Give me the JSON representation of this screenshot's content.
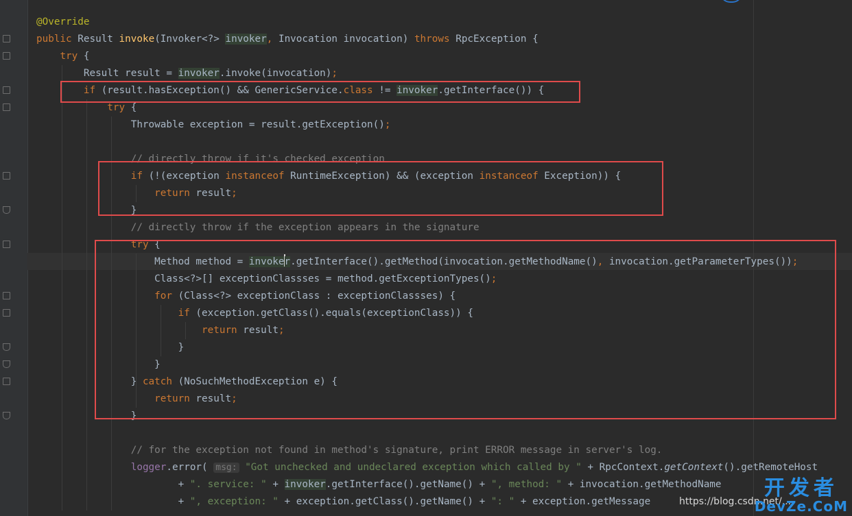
{
  "editor": {
    "lines": [
      [
        {
          "t": "@Override",
          "c": "ann"
        }
      ],
      [
        {
          "t": "public ",
          "c": "kw"
        },
        {
          "t": "Result "
        },
        {
          "t": "invoke",
          "c": "fn"
        },
        {
          "t": "(Invoker<?> "
        },
        {
          "t": "invoker",
          "c": "hl"
        },
        {
          "t": ", ",
          "c": "kw"
        },
        {
          "t": "Invocation invocation) "
        },
        {
          "t": "throws ",
          "c": "kw"
        },
        {
          "t": "RpcException {"
        }
      ],
      [
        {
          "t": "    "
        },
        {
          "t": "try ",
          "c": "kw"
        },
        {
          "t": "{"
        }
      ],
      [
        {
          "t": "        Result result = "
        },
        {
          "t": "invoker",
          "c": "hl"
        },
        {
          "t": ".invoke(invocation)"
        },
        {
          "t": ";",
          "c": "kw"
        }
      ],
      [
        {
          "t": "        "
        },
        {
          "t": "if ",
          "c": "kw"
        },
        {
          "t": "(result.hasException() && GenericService."
        },
        {
          "t": "class ",
          "c": "kw"
        },
        {
          "t": "!= "
        },
        {
          "t": "invoker",
          "c": "hl"
        },
        {
          "t": ".getInterface()) {"
        }
      ],
      [
        {
          "t": "            "
        },
        {
          "t": "try ",
          "c": "kw"
        },
        {
          "t": "{"
        }
      ],
      [
        {
          "t": "                Throwable exception = result.getException()"
        },
        {
          "t": ";",
          "c": "kw"
        }
      ],
      [],
      [
        {
          "t": "                "
        },
        {
          "t": "// directly throw if it's checked exception",
          "c": "cm"
        }
      ],
      [
        {
          "t": "                "
        },
        {
          "t": "if ",
          "c": "kw"
        },
        {
          "t": "(!(exception "
        },
        {
          "t": "instanceof ",
          "c": "kw"
        },
        {
          "t": "RuntimeException) && (exception "
        },
        {
          "t": "instanceof ",
          "c": "kw"
        },
        {
          "t": "Exception)) {"
        }
      ],
      [
        {
          "t": "                    "
        },
        {
          "t": "return ",
          "c": "kw"
        },
        {
          "t": "result"
        },
        {
          "t": ";",
          "c": "kw"
        }
      ],
      [
        {
          "t": "                }"
        }
      ],
      [
        {
          "t": "                "
        },
        {
          "t": "// directly throw if the exception appears in the signature",
          "c": "cm"
        }
      ],
      [
        {
          "t": "                "
        },
        {
          "t": "try ",
          "c": "kw"
        },
        {
          "t": "{"
        }
      ],
      [
        {
          "t": "                    Method method = "
        },
        {
          "t": "invoke",
          "c": "hl"
        },
        {
          "t": "",
          "c": "cursor"
        },
        {
          "t": "r",
          "c": "hl"
        },
        {
          "t": ".getInterface().getMethod(invocation.getMethodName()"
        },
        {
          "t": ", ",
          "c": "kw"
        },
        {
          "t": "invocation.getParameterTypes())"
        },
        {
          "t": ";",
          "c": "kw"
        }
      ],
      [
        {
          "t": "                    Class<?>[] exceptionClassses = method.getExceptionTypes()"
        },
        {
          "t": ";",
          "c": "kw"
        }
      ],
      [
        {
          "t": "                    "
        },
        {
          "t": "for ",
          "c": "kw"
        },
        {
          "t": "(Class<?> exceptionClass : exceptionClassses) {"
        }
      ],
      [
        {
          "t": "                        "
        },
        {
          "t": "if ",
          "c": "kw"
        },
        {
          "t": "(exception.getClass().equals(exceptionClass)) {"
        }
      ],
      [
        {
          "t": "                            "
        },
        {
          "t": "return ",
          "c": "kw"
        },
        {
          "t": "result"
        },
        {
          "t": ";",
          "c": "kw"
        }
      ],
      [
        {
          "t": "                        }"
        }
      ],
      [
        {
          "t": "                    }"
        }
      ],
      [
        {
          "t": "                } "
        },
        {
          "t": "catch ",
          "c": "kw"
        },
        {
          "t": "(NoSuchMethodException e) {"
        }
      ],
      [
        {
          "t": "                    "
        },
        {
          "t": "return ",
          "c": "kw"
        },
        {
          "t": "result"
        },
        {
          "t": ";",
          "c": "kw"
        }
      ],
      [
        {
          "t": "                }"
        }
      ],
      [],
      [
        {
          "t": "                "
        },
        {
          "t": "// for the exception not found in method's signature, print ERROR message in server's log.",
          "c": "cm"
        }
      ],
      [
        {
          "t": "                "
        },
        {
          "t": "logger",
          "c": "fld"
        },
        {
          "t": ".error( "
        },
        {
          "t": "msg:",
          "c": "hint"
        },
        {
          "t": " "
        },
        {
          "t": "\"Got unchecked and undeclared exception which called by \" ",
          "c": "str"
        },
        {
          "t": "+ RpcContext."
        },
        {
          "t": "getContext",
          "c": "ital"
        },
        {
          "t": "().getRemoteHost"
        }
      ],
      [
        {
          "t": "                        + "
        },
        {
          "t": "\". service: \" ",
          "c": "str"
        },
        {
          "t": "+ "
        },
        {
          "t": "invoker",
          "c": "hl"
        },
        {
          "t": ".getInterface().getName() + "
        },
        {
          "t": "\", method: \" ",
          "c": "str"
        },
        {
          "t": "+ invocation.getMethodName"
        }
      ],
      [
        {
          "t": "                        + "
        },
        {
          "t": "\", exception: \" ",
          "c": "str"
        },
        {
          "t": "+ exception.getClass().getName() + "
        },
        {
          "t": "\": \" ",
          "c": "str"
        },
        {
          "t": "+ exception.getMessage"
        }
      ]
    ]
  },
  "watermark": {
    "url": "https://blog.csdn.net/...",
    "logo_cn": "开发者",
    "logo_en": "DevZe.CoM"
  }
}
